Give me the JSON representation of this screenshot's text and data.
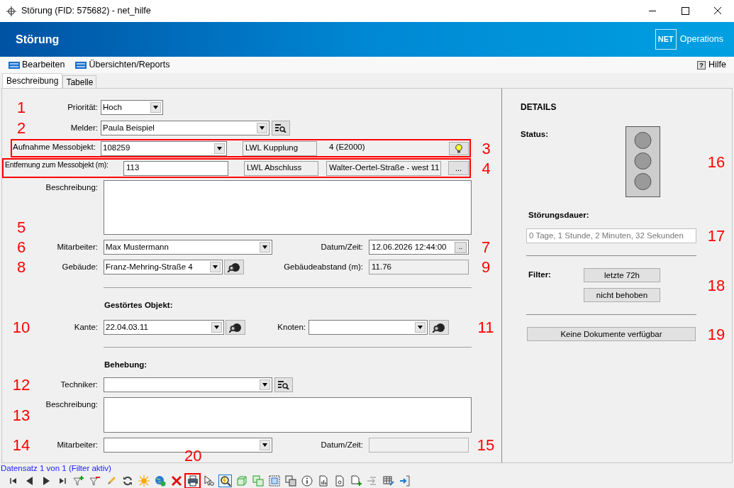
{
  "window": {
    "title": "Störung (FID: 575682) - net_hilfe"
  },
  "header": {
    "title": "Störung",
    "logo": "NET",
    "product": "Operations"
  },
  "menu": {
    "items": [
      {
        "label": "Bearbeiten"
      },
      {
        "label": "Übersichten/Reports"
      }
    ],
    "help_icon": "?",
    "help": "Hilfe"
  },
  "tabs": [
    {
      "label": "Beschreibung",
      "selected": true
    },
    {
      "label": "Tabelle",
      "selected": false
    }
  ],
  "form": {
    "priority": {
      "marker": "1",
      "label": "Priorität:",
      "value": "Hoch"
    },
    "reporter": {
      "marker": "2",
      "label": "Melder:",
      "value": "Paula Beispiel"
    },
    "measure_object": {
      "marker": "3",
      "highlighted": true,
      "label": "Aufnahme Messobjekt:",
      "value": "108259",
      "type": "LWL Kupplung",
      "port": "4 (E2000)"
    },
    "distance": {
      "marker": "4",
      "highlighted": true,
      "label": "Entfernung zum Messobjekt (m):",
      "value": "113",
      "type": "LWL Abschluss",
      "location": "Walter-Oertel-Straße - west 11",
      "button": "..."
    },
    "description": {
      "marker": "5",
      "label": "Beschreibung:"
    },
    "employee": {
      "marker": "6",
      "label": "Mitarbeiter:",
      "value": "Max Mustermann"
    },
    "datetime": {
      "marker": "7",
      "label": "Datum/Zeit:",
      "value": "12.06.2026 12:44:00",
      "button": ".."
    },
    "building": {
      "marker": "8",
      "label": "Gebäude:",
      "value": "Franz-Mehring-Straße 4"
    },
    "building_distance": {
      "marker": "9",
      "label": "Gebäudeabstand (m):",
      "value": "11.76"
    },
    "faulty_object": {
      "heading": "Gestörtes Objekt:",
      "edge": {
        "marker": "10",
        "label": "Kante:",
        "value": "22.04.03.11"
      },
      "node": {
        "marker": "11",
        "label": "Knoten:"
      }
    },
    "resolution": {
      "heading": "Behebung:",
      "technician": {
        "marker": "12",
        "label": "Techniker:"
      },
      "description": {
        "marker": "13",
        "label": "Beschreibung:"
      },
      "employee": {
        "marker": "14",
        "label": "Mitarbeiter:"
      },
      "datetime": {
        "marker": "15",
        "label": "Datum/Zeit:",
        "disabled": true
      }
    }
  },
  "details": {
    "title": "DETAILS",
    "status_label": "Status:",
    "status_marker": "16",
    "duration_label": "Störungsdauer:",
    "duration": "0 Tage, 1 Stunde, 2 Minuten, 32 Sekunden",
    "duration_marker": "17",
    "filter_label": "Filter:",
    "filters": [
      "letzte 72h",
      "nicht behoben"
    ],
    "filter_marker": "18",
    "documents_button": "Keine Dokumente verfügbar",
    "documents_marker": "19"
  },
  "status_bar": {
    "text": "Datensatz 1 von 1 (Filter aktiv)"
  },
  "toolbar": {
    "marker": "20",
    "buttons": [
      {
        "kind": "first",
        "selected": false,
        "marked": false
      },
      {
        "kind": "prev",
        "selected": false,
        "marked": false
      },
      {
        "kind": "next",
        "selected": false,
        "marked": false
      },
      {
        "kind": "last",
        "selected": false,
        "marked": false
      },
      {
        "kind": "filter_add",
        "selected": false,
        "marked": false
      },
      {
        "kind": "filter_remove",
        "selected": false,
        "marked": false
      },
      {
        "kind": "edit",
        "selected": false,
        "marked": false
      },
      {
        "kind": "refresh",
        "selected": false,
        "marked": false
      },
      {
        "kind": "sun",
        "selected": false,
        "marked": false
      },
      {
        "kind": "globe",
        "selected": false,
        "marked": false
      },
      {
        "kind": "delete",
        "selected": false,
        "marked": false
      },
      {
        "kind": "print",
        "selected": false,
        "marked": true
      },
      {
        "kind": "pointer_zoom",
        "selected": false,
        "marked": false
      },
      {
        "kind": "zoom",
        "selected": true,
        "marked": false
      },
      {
        "kind": "cube",
        "selected": false,
        "marked": false
      },
      {
        "kind": "cubes",
        "selected": false,
        "marked": false
      },
      {
        "kind": "cube_dashed",
        "selected": false,
        "marked": false
      },
      {
        "kind": "squares",
        "selected": false,
        "marked": false
      },
      {
        "kind": "info",
        "selected": false,
        "marked": false
      },
      {
        "kind": "report_chart",
        "selected": false,
        "marked": false
      },
      {
        "kind": "report_doc",
        "selected": false,
        "marked": false
      },
      {
        "kind": "report_add",
        "selected": false,
        "marked": false
      },
      {
        "kind": "arrows",
        "selected": false,
        "marked": false
      },
      {
        "kind": "table_edit",
        "selected": false,
        "marked": false
      },
      {
        "kind": "exit",
        "selected": false,
        "marked": false
      }
    ]
  }
}
